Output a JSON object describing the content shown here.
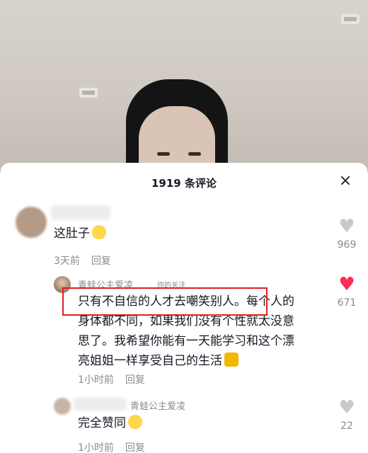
{
  "sheet": {
    "title": "1919 条评论",
    "close_icon": "×"
  },
  "comments": [
    {
      "author": "",
      "text": "这肚子",
      "emoji": "laughing-face",
      "time": "3天前",
      "reply": "回复",
      "likes": "969",
      "liked": false
    },
    {
      "author": "青蛙公主爱凌",
      "tag": "你的关注",
      "text_lines": [
        "只有不自信的人才去嘲笑别人。每个人的",
        "身体都不同，如果我们没有个性就太没意",
        "思了。我希望你能有一天能学习和这个漂",
        "亮姐姐一样享受自己的生活"
      ],
      "emoji": "thumbs-up",
      "time": "1小时前",
      "reply": "回复",
      "likes": "671",
      "liked": true
    },
    {
      "author": "青蛙公主爱凌",
      "text": "完全赞同",
      "emoji": "crying-face",
      "time": "1小时前",
      "reply": "回复",
      "likes": "22",
      "liked": false
    }
  ],
  "colors": {
    "liked_heart": "#fe2c55",
    "heart": "#c9c9cc",
    "highlight": "#e02020"
  }
}
